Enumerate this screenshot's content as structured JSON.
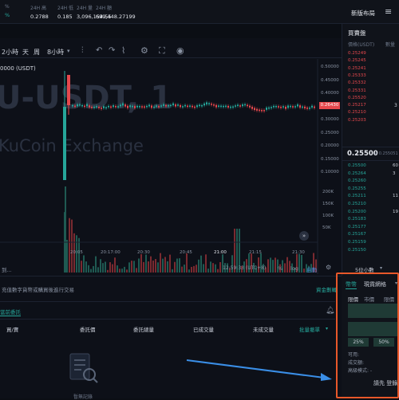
{
  "topbar": {
    "stats": [
      {
        "label": "%",
        "value": "%"
      },
      {
        "label": "24H 高",
        "value": "0.2788"
      },
      {
        "label": "24H 低",
        "value": "0.185"
      },
      {
        "label": "24H 量",
        "value": "3,096,154.55"
      },
      {
        "label": "24H 額",
        "value": "699,448.27199"
      }
    ],
    "new_label": "新版布局"
  },
  "chart_toolbar": {
    "items": [
      "2小時",
      "天",
      "周",
      "8小時"
    ]
  },
  "chart": {
    "watermark_pair": "U-USDT, 1",
    "watermark_exchange": "KuCoin Exchange",
    "price_tag_left": "0000 (USDT)",
    "current_price": "0.26430",
    "price_axis": [
      "0.50000",
      "0.45000",
      "0.40000",
      "0.35000",
      "0.30000",
      "0.25000",
      "0.20000",
      "0.15000",
      "0.10000"
    ],
    "vol_axis": [
      "200K",
      "150K",
      "100K",
      "50K"
    ],
    "time_axis": [
      "20:05",
      "20:17:00",
      "20:30",
      "20:45",
      "21:00",
      "21:15",
      "21:30"
    ],
    "status_time": "12:59:33 (UTC+8)",
    "status_pct": "%",
    "status_log": "log",
    "status_auto": "自動",
    "left_text": "到..."
  },
  "orderbook": {
    "title": "買賣盤",
    "col_price": "價格(USDT)",
    "col_qty": "數量",
    "asks": [
      "0.25249",
      "0.25245",
      "0.25241",
      "0.25333",
      "0.25332",
      "0.25331",
      "0.25520",
      "0.25217",
      "0.25210",
      "0.25203"
    ],
    "ask_qty_marker": "3",
    "last_price": "0.25500",
    "last_sub": "≈ 0.255051",
    "bids": [
      "0.25500",
      "0.25264",
      "0.25260",
      "0.25255",
      "0.25211",
      "0.25210",
      "0.25200",
      "0.25183",
      "0.25177",
      "0.25167",
      "0.25159",
      "0.25150"
    ],
    "bid_qty": [
      "60",
      "3",
      "",
      "",
      "11",
      "",
      "19",
      "",
      "",
      "",
      "",
      ""
    ],
    "decimals_label": "5位小數"
  },
  "bottom": {
    "notice": "充值數字貨幣或購買後進行交易",
    "notice_link": "資金劃轉",
    "tab_active": "當前委託",
    "columns": [
      "買/賣",
      "委託價",
      "委託總量",
      "已成交量",
      "未成交量",
      "批量撤單"
    ],
    "empty_label": "暫無記錄"
  },
  "trade": {
    "tabs": [
      "幣幣",
      "現貨網格"
    ],
    "order_types": [
      "限價",
      "市價",
      "限價止"
    ],
    "pct_buttons": [
      "25%",
      "50%"
    ],
    "available": "可用:",
    "deal_amount": "成交額:",
    "advanced": "高級模式: -",
    "login_hint": "請先 登錄"
  },
  "colors": {
    "up": "#26a69a",
    "down": "#e5484d",
    "accent": "#e8582a"
  }
}
